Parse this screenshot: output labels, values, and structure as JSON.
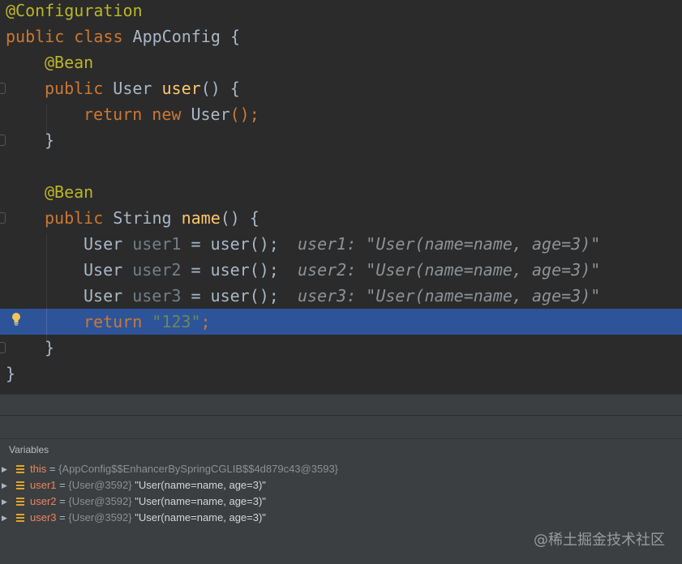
{
  "editor": {
    "lines": [
      {
        "a": "@Configuration"
      },
      {
        "k": "public class ",
        "n": "AppConfig",
        "p": " {"
      },
      {
        "a": "@Bean"
      },
      {
        "k": "public ",
        "t": "User ",
        "f": "user",
        "p": "() {"
      },
      {
        "k": "return new ",
        "t": "User",
        "p": "();"
      },
      {
        "p": "}"
      },
      {
        "a": "@Bean"
      },
      {
        "k": "public ",
        "t": "String ",
        "f": "name",
        "p": "() {"
      },
      {
        "t": "User ",
        "v": "user1",
        "e": " = user();",
        "h": "user1: \"User(name=name, age=3)\""
      },
      {
        "t": "User ",
        "v": "user2",
        "e": " = user();",
        "h": "user2: \"User(name=name, age=3)\""
      },
      {
        "t": "User ",
        "v": "user3",
        "e": " = user();",
        "h": "user3: \"User(name=name, age=3)\""
      },
      {
        "k": "return ",
        "s": "\"123\"",
        "p": ";"
      },
      {
        "p": "}"
      },
      {
        "p": "}"
      }
    ]
  },
  "debugger": {
    "panel_title": "Variables",
    "variables": [
      {
        "name": "this",
        "eq": " = ",
        "type": "{AppConfig$$EnhancerBySpringCGLIB$$4d879c43@3593}",
        "value": ""
      },
      {
        "name": "user1",
        "eq": " = ",
        "type": "{User@3592}",
        "value": " \"User(name=name, age=3)\""
      },
      {
        "name": "user2",
        "eq": " = ",
        "type": "{User@3592}",
        "value": " \"User(name=name, age=3)\""
      },
      {
        "name": "user3",
        "eq": " = ",
        "type": "{User@3592}",
        "value": " \"User(name=name, age=3)\""
      }
    ]
  },
  "watermark": "@稀土掘金技术社区",
  "colors": {
    "background": "#2b2b2b",
    "execution_line": "#2d5499",
    "keyword": "#cc7832",
    "annotation": "#bbb529",
    "function": "#ffc66d",
    "string": "#6a8759",
    "variable_name": "#e8845f"
  }
}
